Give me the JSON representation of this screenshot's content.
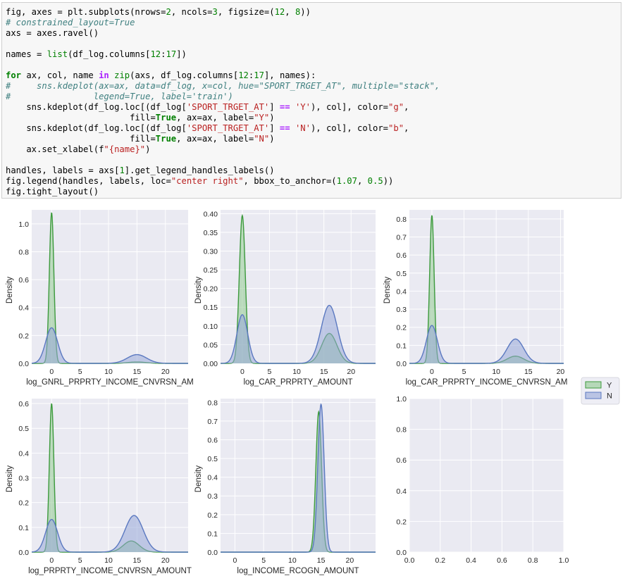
{
  "code_cell": {
    "lines": [
      [
        [
          "txt",
          "fig, axes = plt.subplots(nrows="
        ],
        [
          "num",
          "2"
        ],
        [
          "txt",
          ", ncols="
        ],
        [
          "num",
          "3"
        ],
        [
          "txt",
          ", figsize=("
        ],
        [
          "num",
          "12"
        ],
        [
          "txt",
          ", "
        ],
        [
          "num",
          "8"
        ],
        [
          "txt",
          "))"
        ]
      ],
      [
        [
          "cmt",
          "# constrained_layout=True"
        ]
      ],
      [
        [
          "txt",
          "axs = axes.ravel()"
        ]
      ],
      [],
      [
        [
          "txt",
          "names = "
        ],
        [
          "bi",
          "list"
        ],
        [
          "txt",
          "(df_log.columns["
        ],
        [
          "num",
          "12"
        ],
        [
          "txt",
          ":"
        ],
        [
          "num",
          "17"
        ],
        [
          "txt",
          "])"
        ]
      ],
      [],
      [
        [
          "kw",
          "for"
        ],
        [
          "txt",
          " ax, col, name "
        ],
        [
          "op",
          "in"
        ],
        [
          "txt",
          " "
        ],
        [
          "bi",
          "zip"
        ],
        [
          "txt",
          "(axs, df_log.columns["
        ],
        [
          "num",
          "12"
        ],
        [
          "txt",
          ":"
        ],
        [
          "num",
          "17"
        ],
        [
          "txt",
          "], names):"
        ]
      ],
      [
        [
          "cmt",
          "#     sns.kdeplot(ax=ax, data=df_log, x=col, hue=\"SPORT_TRGET_AT\", multiple=\"stack\","
        ]
      ],
      [
        [
          "cmt",
          "#                legend=True, label='train')"
        ]
      ],
      [
        [
          "txt",
          "    sns.kdeplot(df_log.loc[(df_log["
        ],
        [
          "str",
          "'SPORT_TRGET_AT'"
        ],
        [
          "txt",
          "] "
        ],
        [
          "op",
          "=="
        ],
        [
          "txt",
          " "
        ],
        [
          "str",
          "'Y'"
        ],
        [
          "txt",
          "), col], color="
        ],
        [
          "str",
          "\"g\""
        ],
        [
          "txt",
          ","
        ]
      ],
      [
        [
          "txt",
          "                        fill="
        ],
        [
          "kw",
          "True"
        ],
        [
          "txt",
          ", ax=ax, label="
        ],
        [
          "str",
          "\"Y\""
        ],
        [
          "txt",
          ")"
        ]
      ],
      [
        [
          "txt",
          "    sns.kdeplot(df_log.loc[(df_log["
        ],
        [
          "str",
          "'SPORT_TRGET_AT'"
        ],
        [
          "txt",
          "] "
        ],
        [
          "op",
          "=="
        ],
        [
          "txt",
          " "
        ],
        [
          "str",
          "'N'"
        ],
        [
          "txt",
          "), col], color="
        ],
        [
          "str",
          "\"b\""
        ],
        [
          "txt",
          ","
        ]
      ],
      [
        [
          "txt",
          "                        fill="
        ],
        [
          "kw",
          "True"
        ],
        [
          "txt",
          ", ax=ax, label="
        ],
        [
          "str",
          "\"N\""
        ],
        [
          "txt",
          ")"
        ]
      ],
      [
        [
          "txt",
          "    ax.set_xlabel(f"
        ],
        [
          "str",
          "\"{name}\""
        ],
        [
          "txt",
          ")"
        ]
      ],
      [],
      [
        [
          "txt",
          "handles, labels = axs["
        ],
        [
          "num",
          "1"
        ],
        [
          "txt",
          "].get_legend_handles_labels()"
        ]
      ],
      [
        [
          "txt",
          "fig.legend(handles, labels, loc="
        ],
        [
          "str",
          "\"center right\""
        ],
        [
          "txt",
          ", bbox_to_anchor=("
        ],
        [
          "num",
          "1.07"
        ],
        [
          "txt",
          ", "
        ],
        [
          "num",
          "0.5"
        ],
        [
          "txt",
          "))"
        ]
      ],
      [
        [
          "txt",
          "fig.tight_layout()"
        ]
      ]
    ]
  },
  "colors": {
    "axes_bg": "#eaeaf2",
    "grid": "#ffffff",
    "green_line": "#3d9a3d",
    "green_fill": "#8fc98f",
    "blue_line": "#5a78c0",
    "blue_fill": "#97a8d8"
  },
  "chart_data": [
    {
      "type": "area",
      "xlabel": "log_GNRL_PRPRTY_INCOME_CNVRSN_AM",
      "ylabel": "Density",
      "xlim": [
        -3.5,
        24
      ],
      "ylim": [
        0,
        1.1
      ],
      "xticks": [
        0,
        5,
        10,
        15,
        20
      ],
      "yticks": [
        0.0,
        0.2,
        0.4,
        0.6,
        0.8,
        1.0
      ],
      "ytick_labels": [
        "0.0",
        "0.2",
        "0.4",
        "0.6",
        "0.8",
        "1.0"
      ],
      "series": [
        {
          "name": "Y",
          "color": "green",
          "peaks": [
            [
              0,
              1.08,
              0.4
            ],
            [
              15,
              0.01,
              1.6
            ]
          ]
        },
        {
          "name": "N",
          "color": "blue",
          "peaks": [
            [
              0,
              0.255,
              1.05
            ],
            [
              15,
              0.063,
              1.7
            ]
          ]
        }
      ]
    },
    {
      "type": "area",
      "xlabel": "log_CAR_PRPRTY_AMOUNT",
      "ylabel": "Density",
      "xlim": [
        -4,
        24.5
      ],
      "ylim": [
        0,
        0.41
      ],
      "xticks": [
        0,
        5,
        10,
        15,
        20
      ],
      "yticks": [
        0.0,
        0.05,
        0.1,
        0.15,
        0.2,
        0.25,
        0.3,
        0.35,
        0.4
      ],
      "ytick_labels": [
        "0.00",
        "0.05",
        "0.10",
        "0.15",
        "0.20",
        "0.25",
        "0.30",
        "0.35",
        "0.40"
      ],
      "series": [
        {
          "name": "Y",
          "color": "green",
          "peaks": [
            [
              0,
              0.395,
              0.55
            ],
            [
              16,
              0.08,
              1.4
            ]
          ]
        },
        {
          "name": "N",
          "color": "blue",
          "peaks": [
            [
              0,
              0.13,
              1.0
            ],
            [
              16,
              0.155,
              1.5
            ]
          ]
        }
      ]
    },
    {
      "type": "area",
      "xlabel": "log_CAR_PRPRTY_INCOME_CNVRSN_AM",
      "ylabel": "Density",
      "xlim": [
        -3.5,
        20.5
      ],
      "ylim": [
        0,
        0.85
      ],
      "xticks": [
        0,
        5,
        10,
        15,
        20
      ],
      "yticks": [
        0.0,
        0.1,
        0.2,
        0.3,
        0.4,
        0.5,
        0.6,
        0.7,
        0.8
      ],
      "ytick_labels": [
        "0.0",
        "0.1",
        "0.2",
        "0.3",
        "0.4",
        "0.5",
        "0.6",
        "0.7",
        "0.8"
      ],
      "series": [
        {
          "name": "Y",
          "color": "green",
          "peaks": [
            [
              0,
              0.82,
              0.35
            ],
            [
              13,
              0.04,
              1.3
            ]
          ]
        },
        {
          "name": "N",
          "color": "blue",
          "peaks": [
            [
              0,
              0.21,
              0.85
            ],
            [
              13,
              0.135,
              1.3
            ]
          ]
        }
      ]
    },
    {
      "type": "area",
      "xlabel": "log_PRPRTY_INCOME_CNVRSN_AMOUNT",
      "ylabel": "Density",
      "xlim": [
        -3.5,
        24
      ],
      "ylim": [
        0,
        0.62
      ],
      "xticks": [
        0,
        5,
        10,
        15,
        20
      ],
      "yticks": [
        0.0,
        0.1,
        0.2,
        0.3,
        0.4,
        0.5,
        0.6
      ],
      "ytick_labels": [
        "0.0",
        "0.1",
        "0.2",
        "0.3",
        "0.4",
        "0.5",
        "0.6"
      ],
      "series": [
        {
          "name": "Y",
          "color": "green",
          "peaks": [
            [
              0,
              0.6,
              0.4
            ],
            [
              14,
              0.045,
              1.4
            ]
          ]
        },
        {
          "name": "N",
          "color": "blue",
          "peaks": [
            [
              0,
              0.132,
              1.05
            ],
            [
              14.5,
              0.148,
              1.6
            ]
          ]
        }
      ]
    },
    {
      "type": "area",
      "xlabel": "log_INCOME_RCOGN_AMOUNT",
      "ylabel": "Density",
      "xlim": [
        -2.5,
        24.5
      ],
      "ylim": [
        0,
        0.82
      ],
      "xticks": [
        0,
        5,
        10,
        15,
        20
      ],
      "yticks": [
        0.0,
        0.1,
        0.2,
        0.3,
        0.4,
        0.5,
        0.6,
        0.7,
        0.8
      ],
      "ytick_labels": [
        "0.0",
        "0.1",
        "0.2",
        "0.3",
        "0.4",
        "0.5",
        "0.6",
        "0.7",
        "0.8"
      ],
      "series": [
        {
          "name": "Y",
          "color": "green",
          "peaks": [
            [
              14.6,
              0.75,
              0.5
            ]
          ]
        },
        {
          "name": "N",
          "color": "blue",
          "peaks": [
            [
              15,
              0.79,
              0.55
            ]
          ]
        }
      ]
    },
    {
      "type": "line",
      "xlabel": "",
      "ylabel": "",
      "xlim": [
        0,
        1
      ],
      "ylim": [
        0,
        1
      ],
      "xticks": [
        0,
        0.2,
        0.4,
        0.6,
        0.8,
        1.0
      ],
      "xtick_labels": [
        "0.0",
        "0.2",
        "0.4",
        "0.6",
        "0.8",
        "1.0"
      ],
      "yticks": [
        0,
        0.2,
        0.4,
        0.6,
        0.8,
        1.0
      ],
      "ytick_labels": [
        "0.0",
        "0.2",
        "0.4",
        "0.6",
        "0.8",
        "1.0"
      ],
      "series": []
    }
  ],
  "legend": {
    "placement": "center-right",
    "entries": [
      {
        "label": "Y",
        "color": "green"
      },
      {
        "label": "N",
        "color": "blue"
      }
    ]
  }
}
